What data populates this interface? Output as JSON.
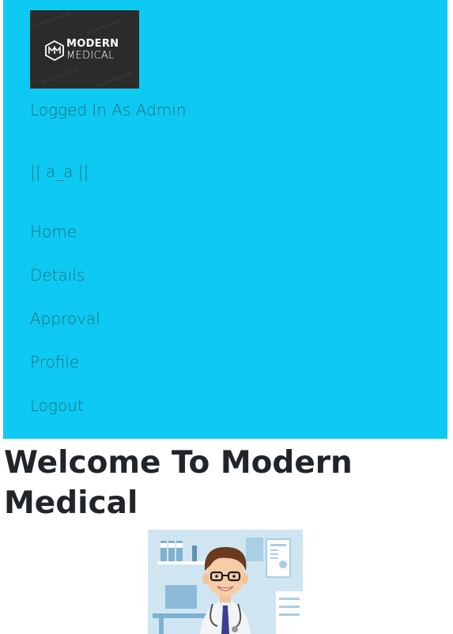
{
  "logo": {
    "line1": "MODERN",
    "line2": "MEDICAL",
    "monogram": "MM",
    "watermark": "modernmedical"
  },
  "sidebar": {
    "logged_in_text": "Logged In As Admin",
    "username": "|| a_a ||",
    "nav": [
      {
        "label": "Home"
      },
      {
        "label": "Details"
      },
      {
        "label": "Approval"
      },
      {
        "label": "Profile"
      },
      {
        "label": "Logout"
      }
    ]
  },
  "main": {
    "heading": "Welcome To Modern Medical"
  },
  "colors": {
    "sidebar_bg": "#0ec9f1",
    "sidebar_text": "#15707e",
    "heading": "#212529",
    "logo_bg": "#2b2b2b"
  },
  "icons": {
    "logo": "modern-medical-logo",
    "doctor": "doctor-illustration"
  }
}
